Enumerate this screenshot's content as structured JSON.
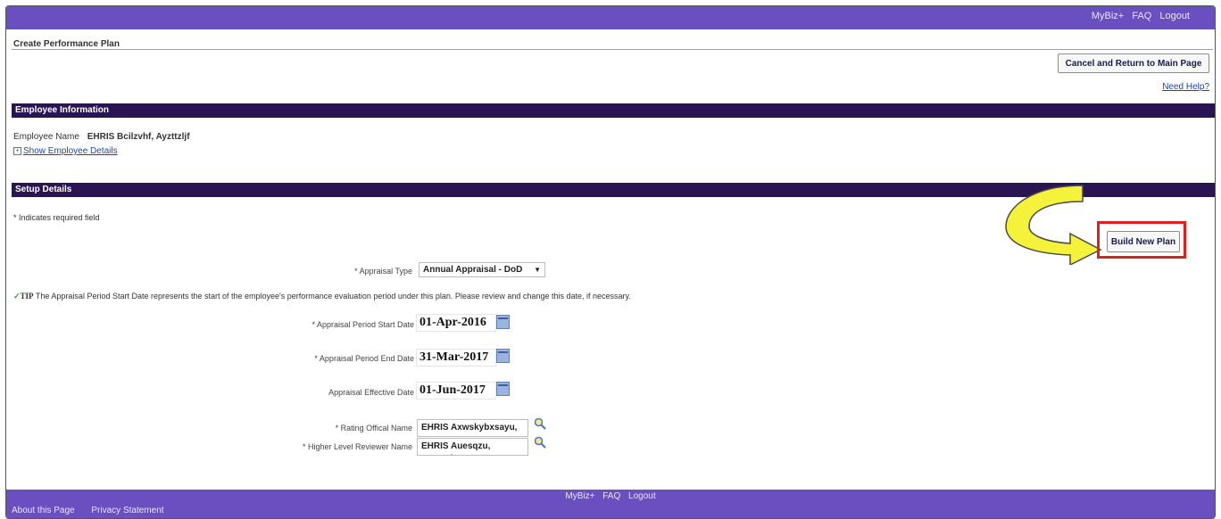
{
  "header": {
    "links": [
      "MyBiz+",
      "FAQ",
      "Logout"
    ]
  },
  "page": {
    "title": "Create Performance Plan"
  },
  "actions": {
    "cancel_label": "Cancel and Return to Main Page",
    "need_help": "Need Help?"
  },
  "employee_section": {
    "title": "Employee Information",
    "name_label": "Employee Name",
    "name_value": "EHRIS Bcilzvhf, Ayzttzljf",
    "show_details": "Show Employee Details"
  },
  "setup_section": {
    "title": "Setup Details",
    "required_note": "* Indicates required field",
    "build_label": "Build New Plan",
    "appraisal_type": {
      "label": "* Appraisal Type",
      "value": "Annual Appraisal - DoD"
    },
    "tip": {
      "word": "TIP",
      "text": "The Appraisal Period Start Date represents the start of the employee's performance evaluation period under this plan. Please review and change this date, if necessary."
    },
    "start_date": {
      "label": "* Appraisal Period Start Date",
      "value": "01-Apr-2016"
    },
    "end_date": {
      "label": "* Appraisal Period End Date",
      "value": "31-Mar-2017"
    },
    "effective_date": {
      "label": "Appraisal Effective Date",
      "value": "01-Jun-2017"
    },
    "rating_official": {
      "label": "* Rating Offical Name",
      "value": "EHRIS Axwskybxsayu, F"
    },
    "higher_reviewer": {
      "label": "* Higher Level Reviewer Name",
      "value": "EHRIS Auesqzu, Xcnaxd"
    }
  },
  "footer": {
    "center_links": [
      "MyBiz+",
      "FAQ",
      "Logout"
    ],
    "left_links": [
      "About this Page",
      "Privacy Statement"
    ]
  },
  "colors": {
    "header_purple": "#6a4fc0",
    "section_bar": "#2b1452",
    "highlight_red": "#e02020",
    "arrow_yellow": "#f4f23a"
  }
}
